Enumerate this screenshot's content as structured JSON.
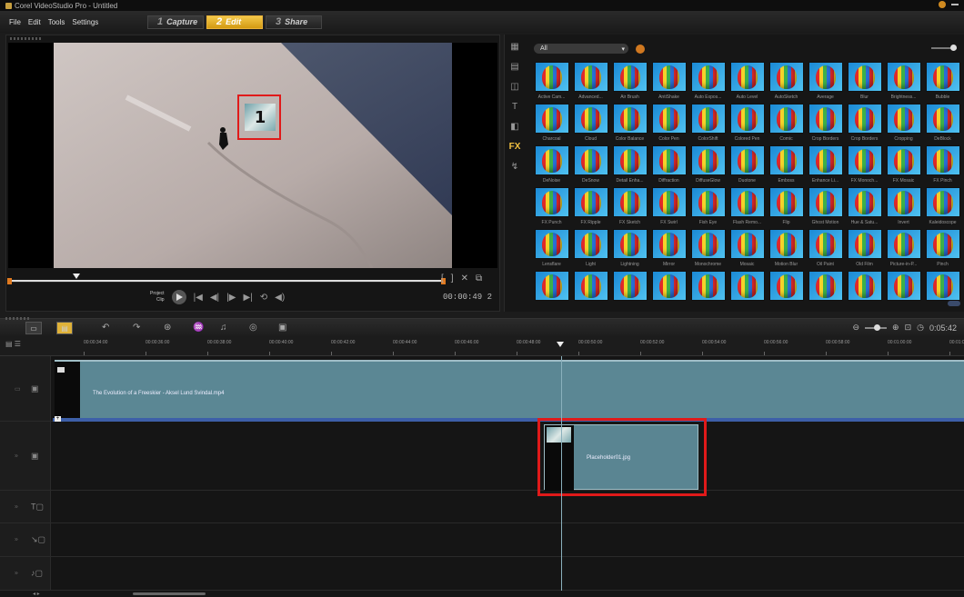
{
  "window": {
    "title": "Corel VideoStudio Pro - Untitled"
  },
  "menu": [
    "File",
    "Edit",
    "Tools",
    "Settings"
  ],
  "steps": [
    {
      "num": "1",
      "label": "Capture"
    },
    {
      "num": "2",
      "label": "Edit",
      "active": true
    },
    {
      "num": "3",
      "label": "Share"
    }
  ],
  "preview": {
    "overlay_number": "1",
    "mode_project": "Project",
    "mode_clip": "Clip",
    "timecode": "00:00:49 2",
    "trim_icons": [
      "[",
      "]",
      "✕",
      "⧉"
    ],
    "transport_icons": [
      "|◀",
      "◀|",
      "|▶",
      "▶|",
      "⟲",
      "◀)"
    ]
  },
  "library": {
    "filter_value": "All",
    "side_icons": [
      "media-icon",
      "instant-project-icon",
      "transition-icon",
      "title-icon",
      "graphic-icon",
      "fx-icon",
      "path-icon"
    ],
    "fx_label": "FX",
    "title_label": "T",
    "effects": [
      "Active Cam...",
      "Advanced...",
      "Air Brush",
      "AntiShake",
      "Auto Expos...",
      "Auto Level",
      "AutoSketch",
      "Average",
      "Blur",
      "Brightness...",
      "Bubble",
      "Charcoal",
      "Cloud",
      "Color Balance",
      "Color Pen",
      "ColorShift",
      "Colored Pen",
      "Comic",
      "Crop Borders",
      "Crop Borders",
      "Cropping",
      "DeBlock",
      "DeNoise",
      "DeSnow",
      "Detail Enha...",
      "Diffraction",
      "DiffuseGlow",
      "Duotone",
      "Emboss",
      "Enhance Li...",
      "FX Monoch...",
      "FX Mosaic",
      "FX Pinch",
      "FX Punch",
      "FX Ripple",
      "FX Sketch",
      "FX Swirl",
      "Fish Eye",
      "Flash Remo...",
      "Flip",
      "Ghost Motion",
      "Hue & Satu...",
      "Invert",
      "Kaleidoscope",
      "Lensflare",
      "Light",
      "Lightning",
      "Mirror",
      "Monochrome",
      "Mosaic",
      "Motion Blur",
      "Oil Paint",
      "Old Film",
      "Picture-in-P...",
      "Pinch",
      "",
      "",
      "",
      "",
      "",
      "",
      "",
      "",
      "",
      "",
      ""
    ]
  },
  "timeline": {
    "ruler": [
      "00:00:34:00",
      "00:00:36:00",
      "00:00:38:00",
      "00:00:40:00",
      "00:00:42:00",
      "00:00:44:00",
      "00:00:46:00",
      "00:00:48:00",
      "00:00:50:00",
      "00:00:52:00",
      "00:00:54:00",
      "00:00:56:00",
      "00:00:58:00",
      "00:01:00:00",
      "00:01:0"
    ],
    "zoom_time": "0:05:42",
    "video_clip_name": "The Evolution of a Freeskier - Aksel Lund Svindal.mp4",
    "overlay_clip_name": "Placeholder01.jpg"
  },
  "colors": {
    "accent": "#e0b238",
    "clip": "#5b8794",
    "highlight": "#e01a1a"
  }
}
